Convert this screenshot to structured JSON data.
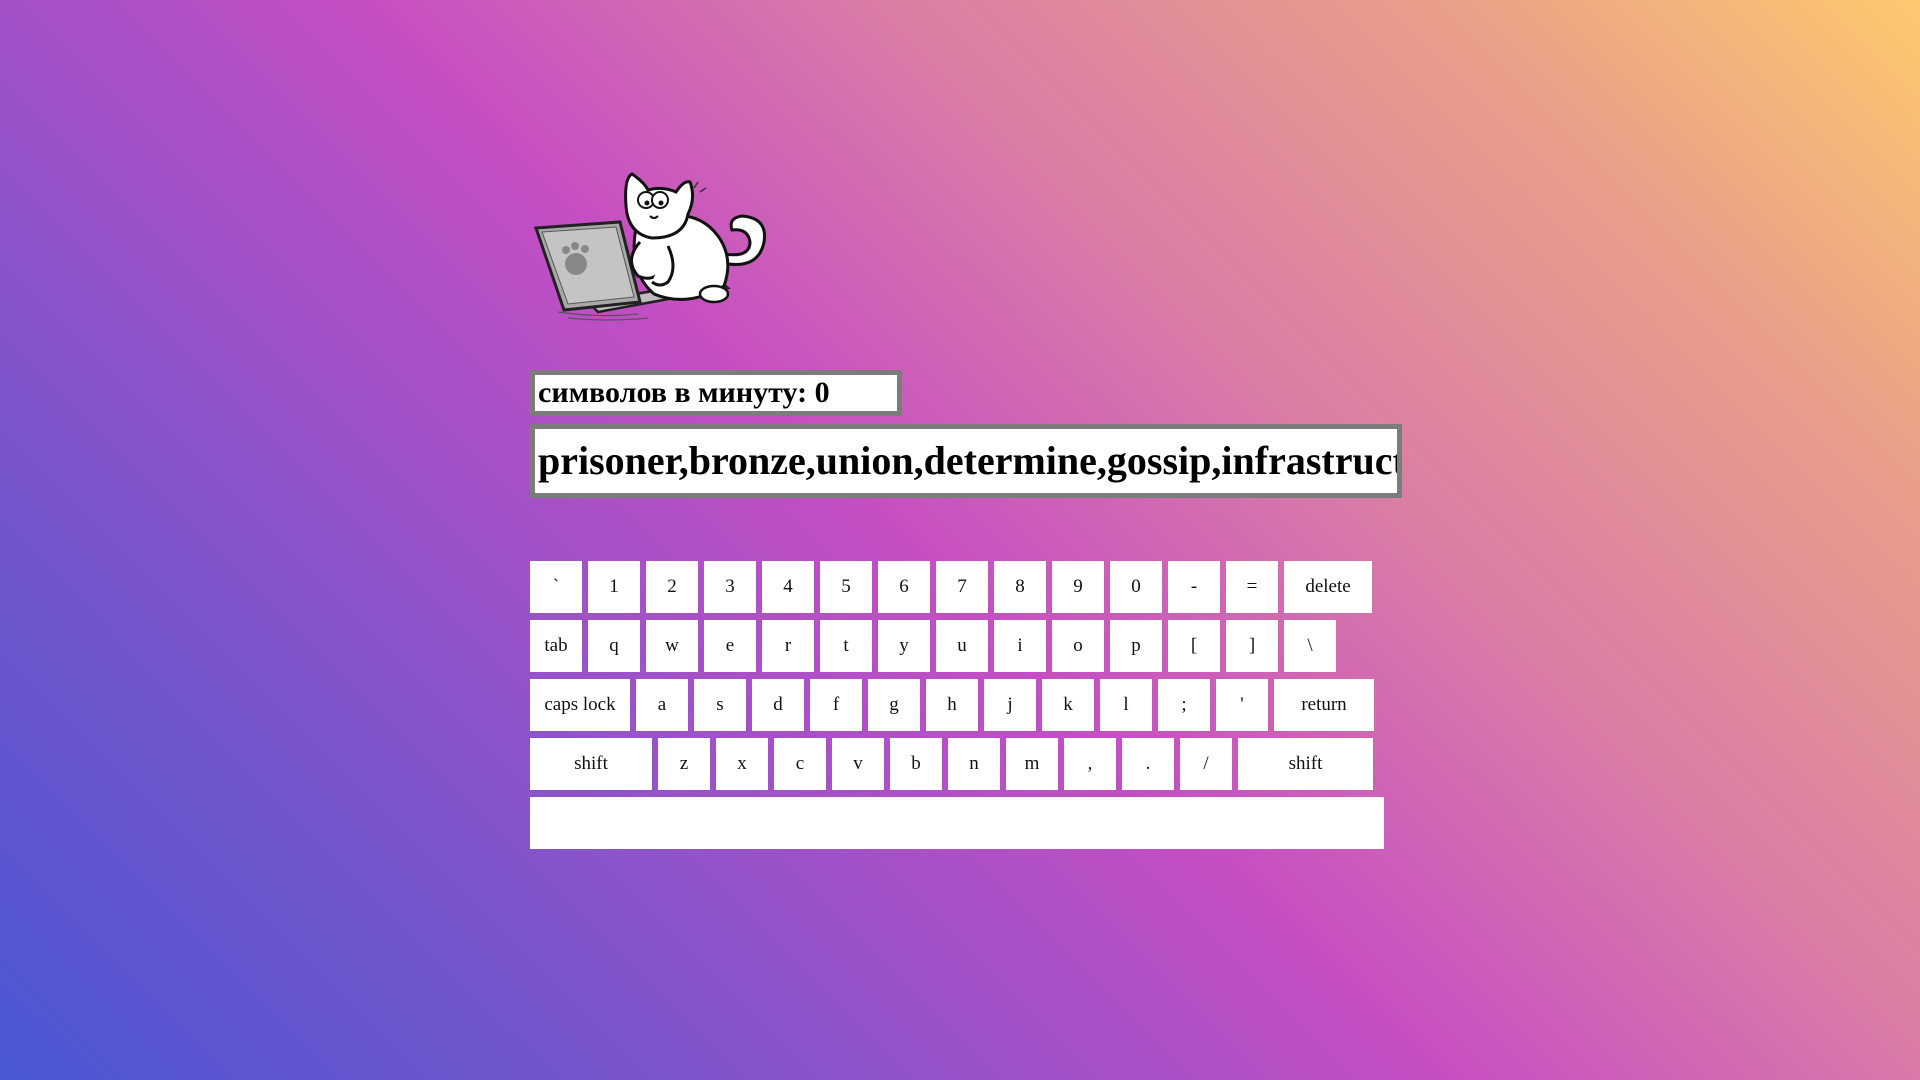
{
  "stats": {
    "label": "символов в минуту: 0"
  },
  "prompt": {
    "text": "prisoner,bronze,union,determine,gossip,infrastructure,"
  },
  "keyboard": {
    "row1": [
      "`",
      "1",
      "2",
      "3",
      "4",
      "5",
      "6",
      "7",
      "8",
      "9",
      "0",
      "-",
      "=",
      "delete"
    ],
    "row2": [
      "tab",
      "q",
      "w",
      "e",
      "r",
      "t",
      "y",
      "u",
      "i",
      "o",
      "p",
      "[",
      "]",
      "\\"
    ],
    "row3": [
      "caps lock",
      "a",
      "s",
      "d",
      "f",
      "g",
      "h",
      "j",
      "k",
      "l",
      ";",
      "'",
      "return"
    ],
    "row4": [
      "shift",
      "z",
      "x",
      "c",
      "v",
      "b",
      "n",
      "m",
      ",",
      ".",
      "/",
      "shift"
    ],
    "row5": [
      ""
    ]
  },
  "mascot": {
    "icon": "cat-typing-laptop-icon"
  }
}
